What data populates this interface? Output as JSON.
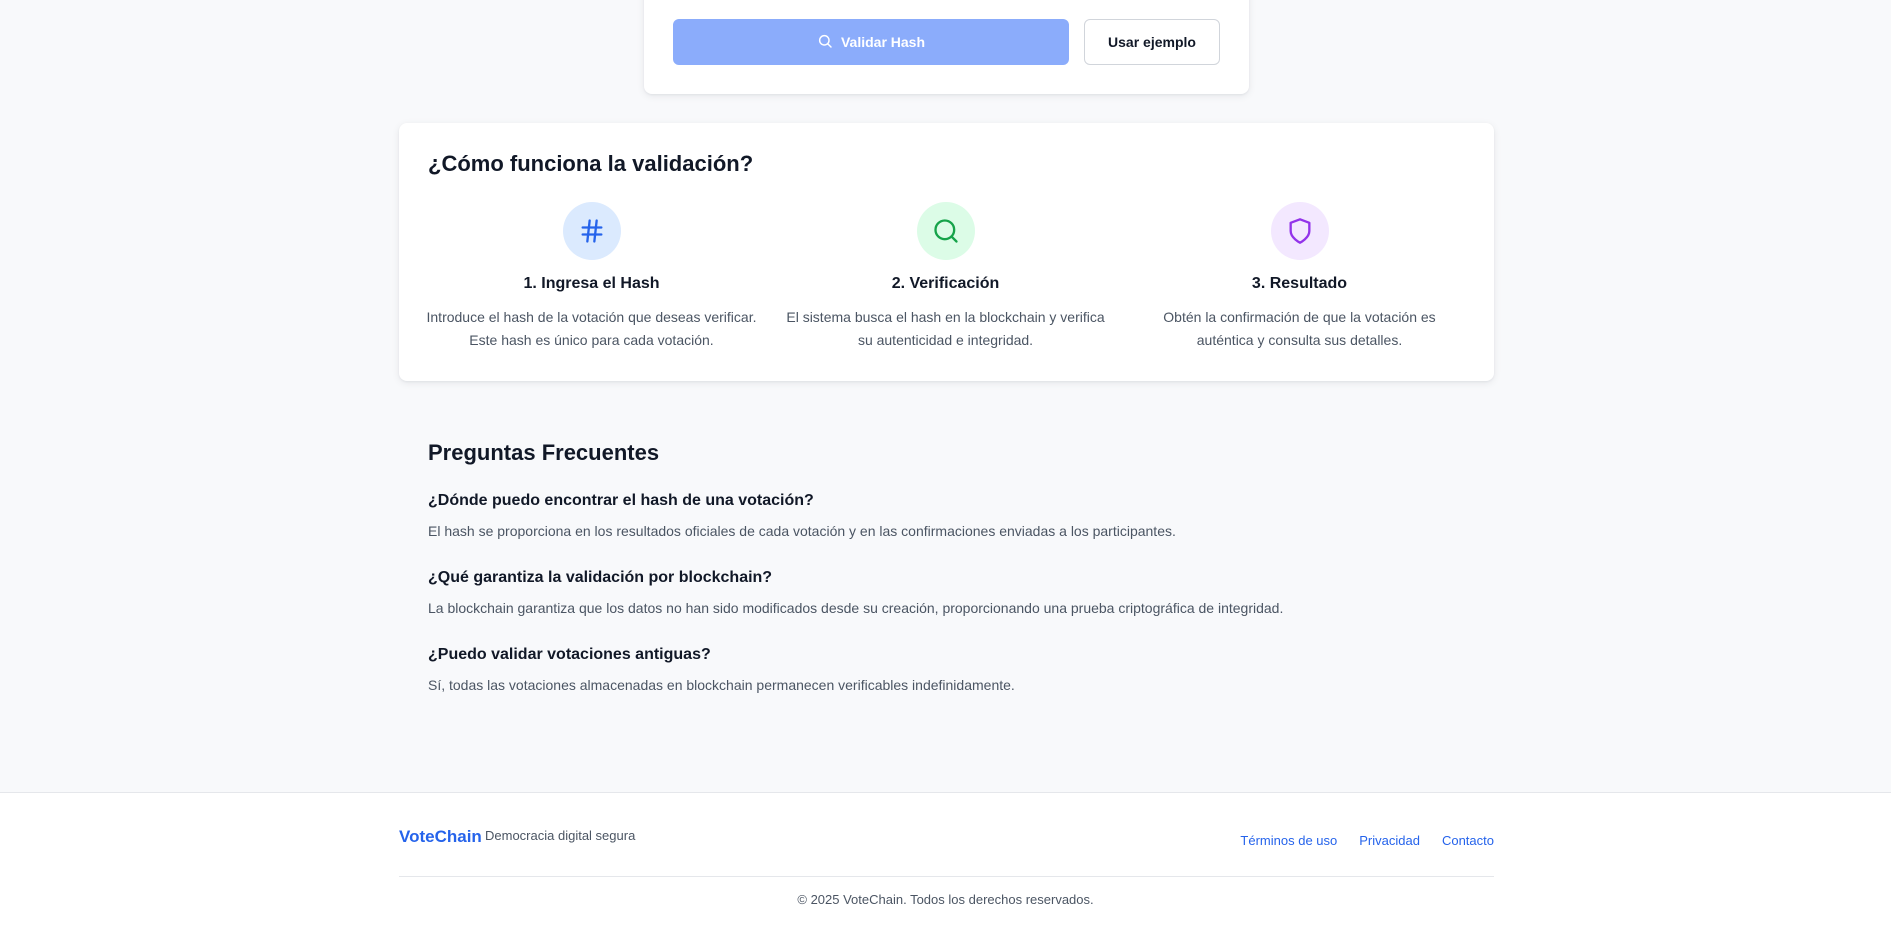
{
  "validate": {
    "validate_label": "Validar Hash",
    "example_label": "Usar ejemplo"
  },
  "how": {
    "title": "¿Cómo funciona la validación?",
    "steps": [
      {
        "icon": "hash-icon",
        "title": "1. Ingresa el Hash",
        "desc": "Introduce el hash de la votación que deseas verificar. Este hash es único para cada votación.",
        "icon_color": "#2563eb",
        "icon_bg": "#dbeafe"
      },
      {
        "icon": "search-icon",
        "title": "2. Verificación",
        "desc": "El sistema busca el hash en la blockchain y verifica su autenticidad e integridad.",
        "icon_color": "#16a34a",
        "icon_bg": "#dcfce7"
      },
      {
        "icon": "shield-icon",
        "title": "3. Resultado",
        "desc": "Obtén la confirmación de que la votación es auténtica y consulta sus detalles.",
        "icon_color": "#9333ea",
        "icon_bg": "#f3e8ff"
      }
    ]
  },
  "faq": {
    "title": "Preguntas Frecuentes",
    "items": [
      {
        "q": "¿Dónde puedo encontrar el hash de una votación?",
        "a": "El hash se proporciona en los resultados oficiales de cada votación y en las confirmaciones enviadas a los participantes."
      },
      {
        "q": "¿Qué garantiza la validación por blockchain?",
        "a": "La blockchain garantiza que los datos no han sido modificados desde su creación, proporcionando una prueba criptográfica de integridad."
      },
      {
        "q": "¿Puedo validar votaciones antiguas?",
        "a": "Sí, todas las votaciones almacenadas en blockchain permanecen verificables indefinidamente."
      }
    ]
  },
  "footer": {
    "brand": "VoteChain",
    "tagline": "Democracia digital segura",
    "links": [
      "Términos de uso",
      "Privacidad",
      "Contacto"
    ],
    "copyright": "© 2025 VoteChain. Todos los derechos reservados."
  },
  "colors": {
    "accent": "#2563eb",
    "validate_button": "#8bacfb",
    "background": "#f8f9fb"
  }
}
